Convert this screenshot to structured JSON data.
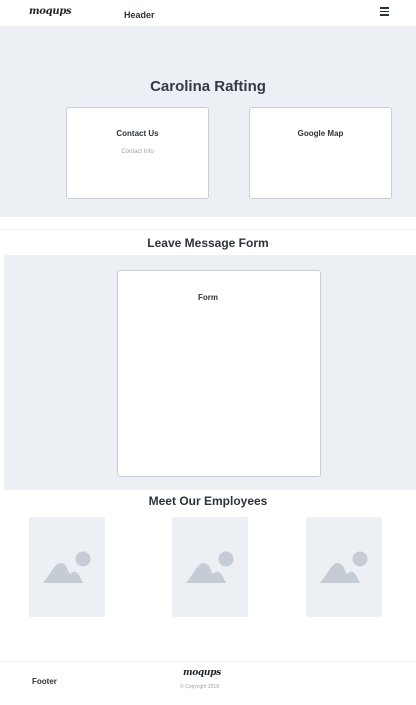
{
  "header": {
    "logo": "moqups",
    "label": "Header",
    "menu_icon": "hamburger-menu-icon"
  },
  "hero": {
    "title": "Carolina Rafting",
    "cards": [
      {
        "title": "Contact Us",
        "subtitle": "Contact Info"
      },
      {
        "title": "Google Map"
      }
    ]
  },
  "form_section": {
    "title": "Leave Message Form",
    "card_title": "Form"
  },
  "employees": {
    "title": "Meet Our Employees",
    "image_icon": "image-placeholder-icon",
    "count": 3
  },
  "footer": {
    "label": "Footer",
    "logo": "moqups",
    "copyright": "© Copyright 2019"
  },
  "colors": {
    "section_bg": "#eceff4",
    "card_border": "#c9ced6",
    "placeholder_shape": "#c5ccd6",
    "text": "#2d333b"
  }
}
